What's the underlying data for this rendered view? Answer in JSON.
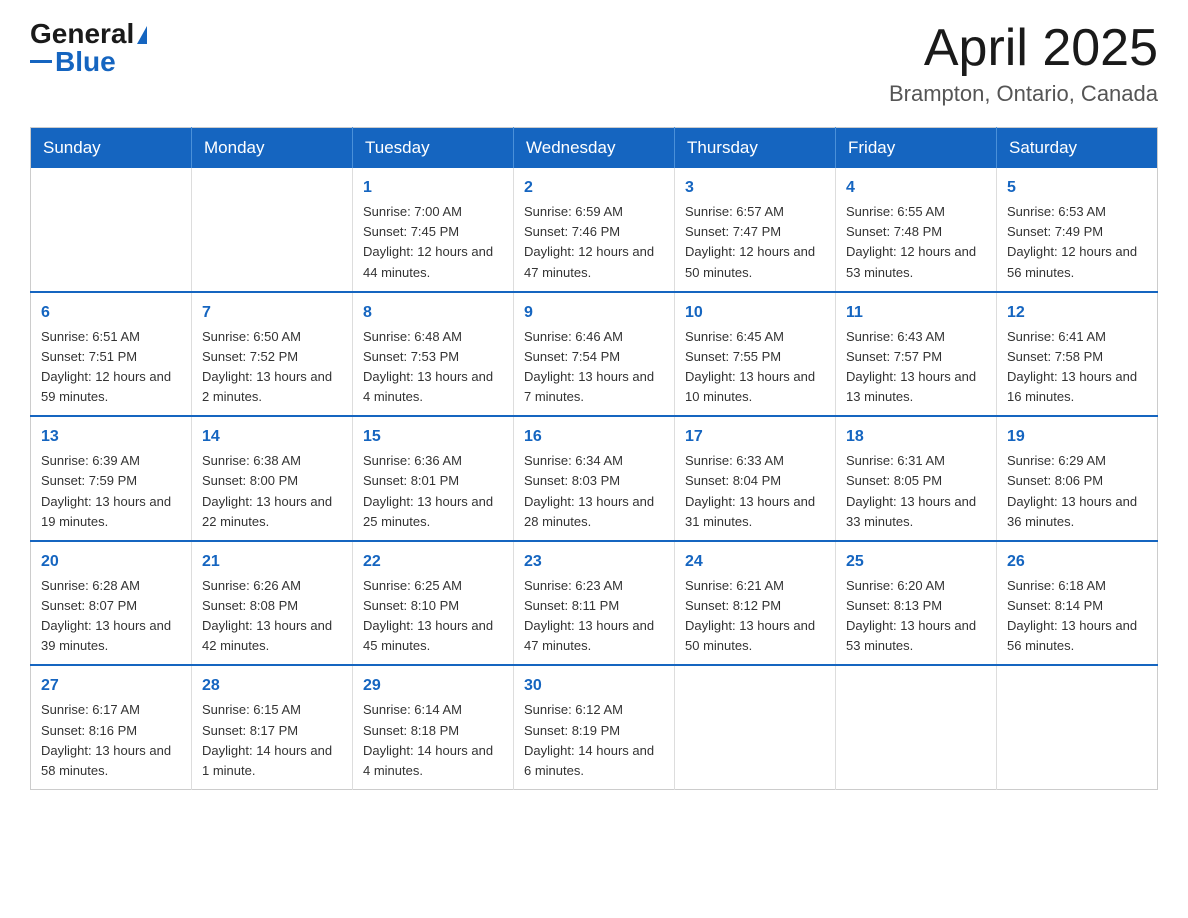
{
  "header": {
    "logo": {
      "general": "General",
      "blue": "Blue",
      "triangle": "▲"
    },
    "title": "April 2025",
    "location": "Brampton, Ontario, Canada"
  },
  "weekdays": [
    "Sunday",
    "Monday",
    "Tuesday",
    "Wednesday",
    "Thursday",
    "Friday",
    "Saturday"
  ],
  "weeks": [
    [
      {
        "day": "",
        "info": ""
      },
      {
        "day": "",
        "info": ""
      },
      {
        "day": "1",
        "info": "Sunrise: 7:00 AM\nSunset: 7:45 PM\nDaylight: 12 hours\nand 44 minutes."
      },
      {
        "day": "2",
        "info": "Sunrise: 6:59 AM\nSunset: 7:46 PM\nDaylight: 12 hours\nand 47 minutes."
      },
      {
        "day": "3",
        "info": "Sunrise: 6:57 AM\nSunset: 7:47 PM\nDaylight: 12 hours\nand 50 minutes."
      },
      {
        "day": "4",
        "info": "Sunrise: 6:55 AM\nSunset: 7:48 PM\nDaylight: 12 hours\nand 53 minutes."
      },
      {
        "day": "5",
        "info": "Sunrise: 6:53 AM\nSunset: 7:49 PM\nDaylight: 12 hours\nand 56 minutes."
      }
    ],
    [
      {
        "day": "6",
        "info": "Sunrise: 6:51 AM\nSunset: 7:51 PM\nDaylight: 12 hours\nand 59 minutes."
      },
      {
        "day": "7",
        "info": "Sunrise: 6:50 AM\nSunset: 7:52 PM\nDaylight: 13 hours\nand 2 minutes."
      },
      {
        "day": "8",
        "info": "Sunrise: 6:48 AM\nSunset: 7:53 PM\nDaylight: 13 hours\nand 4 minutes."
      },
      {
        "day": "9",
        "info": "Sunrise: 6:46 AM\nSunset: 7:54 PM\nDaylight: 13 hours\nand 7 minutes."
      },
      {
        "day": "10",
        "info": "Sunrise: 6:45 AM\nSunset: 7:55 PM\nDaylight: 13 hours\nand 10 minutes."
      },
      {
        "day": "11",
        "info": "Sunrise: 6:43 AM\nSunset: 7:57 PM\nDaylight: 13 hours\nand 13 minutes."
      },
      {
        "day": "12",
        "info": "Sunrise: 6:41 AM\nSunset: 7:58 PM\nDaylight: 13 hours\nand 16 minutes."
      }
    ],
    [
      {
        "day": "13",
        "info": "Sunrise: 6:39 AM\nSunset: 7:59 PM\nDaylight: 13 hours\nand 19 minutes."
      },
      {
        "day": "14",
        "info": "Sunrise: 6:38 AM\nSunset: 8:00 PM\nDaylight: 13 hours\nand 22 minutes."
      },
      {
        "day": "15",
        "info": "Sunrise: 6:36 AM\nSunset: 8:01 PM\nDaylight: 13 hours\nand 25 minutes."
      },
      {
        "day": "16",
        "info": "Sunrise: 6:34 AM\nSunset: 8:03 PM\nDaylight: 13 hours\nand 28 minutes."
      },
      {
        "day": "17",
        "info": "Sunrise: 6:33 AM\nSunset: 8:04 PM\nDaylight: 13 hours\nand 31 minutes."
      },
      {
        "day": "18",
        "info": "Sunrise: 6:31 AM\nSunset: 8:05 PM\nDaylight: 13 hours\nand 33 minutes."
      },
      {
        "day": "19",
        "info": "Sunrise: 6:29 AM\nSunset: 8:06 PM\nDaylight: 13 hours\nand 36 minutes."
      }
    ],
    [
      {
        "day": "20",
        "info": "Sunrise: 6:28 AM\nSunset: 8:07 PM\nDaylight: 13 hours\nand 39 minutes."
      },
      {
        "day": "21",
        "info": "Sunrise: 6:26 AM\nSunset: 8:08 PM\nDaylight: 13 hours\nand 42 minutes."
      },
      {
        "day": "22",
        "info": "Sunrise: 6:25 AM\nSunset: 8:10 PM\nDaylight: 13 hours\nand 45 minutes."
      },
      {
        "day": "23",
        "info": "Sunrise: 6:23 AM\nSunset: 8:11 PM\nDaylight: 13 hours\nand 47 minutes."
      },
      {
        "day": "24",
        "info": "Sunrise: 6:21 AM\nSunset: 8:12 PM\nDaylight: 13 hours\nand 50 minutes."
      },
      {
        "day": "25",
        "info": "Sunrise: 6:20 AM\nSunset: 8:13 PM\nDaylight: 13 hours\nand 53 minutes."
      },
      {
        "day": "26",
        "info": "Sunrise: 6:18 AM\nSunset: 8:14 PM\nDaylight: 13 hours\nand 56 minutes."
      }
    ],
    [
      {
        "day": "27",
        "info": "Sunrise: 6:17 AM\nSunset: 8:16 PM\nDaylight: 13 hours\nand 58 minutes."
      },
      {
        "day": "28",
        "info": "Sunrise: 6:15 AM\nSunset: 8:17 PM\nDaylight: 14 hours\nand 1 minute."
      },
      {
        "day": "29",
        "info": "Sunrise: 6:14 AM\nSunset: 8:18 PM\nDaylight: 14 hours\nand 4 minutes."
      },
      {
        "day": "30",
        "info": "Sunrise: 6:12 AM\nSunset: 8:19 PM\nDaylight: 14 hours\nand 6 minutes."
      },
      {
        "day": "",
        "info": ""
      },
      {
        "day": "",
        "info": ""
      },
      {
        "day": "",
        "info": ""
      }
    ]
  ]
}
